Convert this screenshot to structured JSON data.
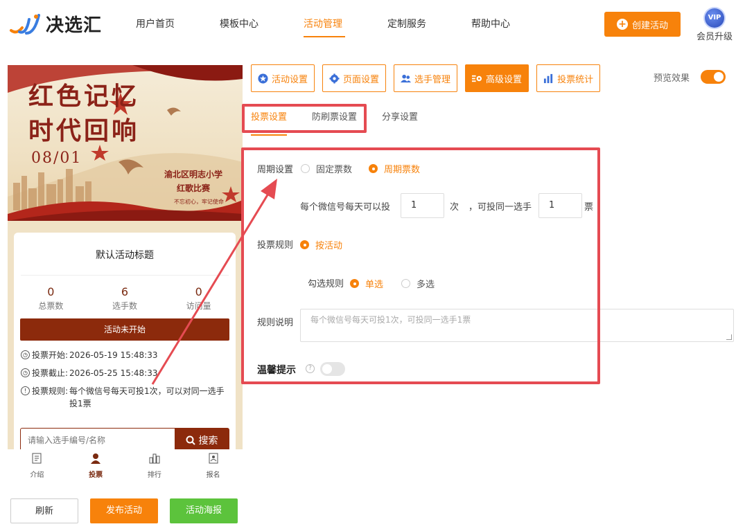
{
  "brand": {
    "name": "决选汇",
    "accent": "#f7820b",
    "highlight": "#e54b52"
  },
  "nav": [
    {
      "label": "用户首页",
      "active": false
    },
    {
      "label": "模板中心",
      "active": false
    },
    {
      "label": "活动管理",
      "active": true
    },
    {
      "label": "定制服务",
      "active": false
    },
    {
      "label": "帮助中心",
      "active": false
    }
  ],
  "header": {
    "create_label": "创建活动",
    "vip_badge": "VIP",
    "vip_label": "会员升级"
  },
  "poster": {
    "title_line1": "红色记忆",
    "title_line2": "时代回响",
    "date": "08/01",
    "org_line1": "渝北区明志小学",
    "org_line2": "红歌比赛",
    "slogan": "不忘初心，牢记使命"
  },
  "activity": {
    "title": "默认活动标题",
    "stats": [
      {
        "value": "0",
        "label": "总票数"
      },
      {
        "value": "6",
        "label": "选手数"
      },
      {
        "value": "0",
        "label": "访问量"
      }
    ],
    "status": "活动未开始",
    "vote_start_label": "投票开始:",
    "vote_start": "2026-05-19 15:48:33",
    "vote_end_label": "投票截止:",
    "vote_end": "2026-05-25 15:48:33",
    "vote_rule_label": "投票规则:",
    "vote_rule": "每个微信号每天可投1次，可以对同一选手投1票",
    "search_placeholder": "请输入选手编号/名称",
    "search_label": "搜索"
  },
  "phone_tabs": [
    {
      "label": "介绍",
      "icon": "doc-icon"
    },
    {
      "label": "投票",
      "icon": "person-icon"
    },
    {
      "label": "排行",
      "icon": "bars-icon"
    },
    {
      "label": "报名",
      "icon": "signup-icon"
    }
  ],
  "bottom_buttons": {
    "refresh": "刷新",
    "publish": "发布活动",
    "poster": "活动海报"
  },
  "settings_tabs": [
    {
      "label": "活动设置",
      "icon": "star-icon",
      "active": false
    },
    {
      "label": "页面设置",
      "icon": "gear-icon",
      "active": false
    },
    {
      "label": "选手管理",
      "icon": "users-icon",
      "active": false
    },
    {
      "label": "高级设置",
      "icon": "cogs-icon",
      "active": true
    },
    {
      "label": "投票统计",
      "icon": "chart-icon",
      "active": false
    }
  ],
  "preview_toggle": {
    "label": "预览效果",
    "on": true
  },
  "sub_tabs": [
    {
      "label": "投票设置",
      "active": true
    },
    {
      "label": "防刷票设置",
      "active": false
    },
    {
      "label": "分享设置",
      "active": false
    }
  ],
  "form": {
    "cycle_label": "周期设置",
    "cycle_fixed": "固定票数",
    "cycle_period": "周期票数",
    "per_day_prefix": "每个微信号每天可以投",
    "per_day_value": "1",
    "per_day_unit": "次",
    "per_player_prefix": "，可投同一选手",
    "per_player_value": "1",
    "per_player_unit": "票",
    "rule_label": "投票规则",
    "rule_by_activity": "按活动",
    "check_rule_label": "勾选规则",
    "single": "单选",
    "multi": "多选",
    "desc_label": "规则说明",
    "desc_value": "每个微信号每天可投1次，可投同一选手1票",
    "tip_label": "温馨提示",
    "tip_on": false
  }
}
